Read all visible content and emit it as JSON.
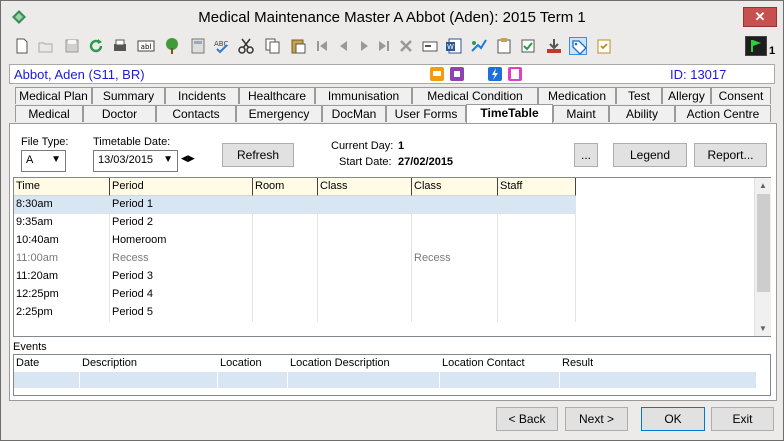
{
  "window": {
    "title": "Medical Maintenance   Master A Abbot (Aden): 2015 Term 1",
    "close_symbol": "✕"
  },
  "toolbar": {
    "icons": [
      "new-doc-icon",
      "open-icon",
      "save-icon",
      "refresh-icon",
      "print-icon",
      "abl-icon",
      "tree-icon",
      "calculator-icon",
      "spellcheck-icon",
      "cut-icon",
      "copy-icon",
      "paste-icon",
      "first-icon",
      "prev-icon",
      "next-icon",
      "last-icon",
      "delete-icon",
      "card-icon",
      "word-icon",
      "forward-icon",
      "clipboard-icon",
      "approve-icon",
      "download-icon",
      "tag-icon",
      "checklist-icon"
    ],
    "right_count": "1"
  },
  "student": {
    "name": "Abbot, Aden (S11, BR)",
    "id_text": "ID: 13017"
  },
  "tabs": {
    "row1": [
      "Medical Plan",
      "Summary",
      "Incidents",
      "Healthcare",
      "Immunisation",
      "Medical Condition",
      "Medication",
      "Test",
      "Allergy",
      "Consent"
    ],
    "row2": [
      "Medical",
      "Doctor",
      "Contacts",
      "Emergency",
      "DocMan",
      "User Forms",
      "TimeTable",
      "Maint",
      "Ability",
      "Action Centre"
    ],
    "selected": "TimeTable"
  },
  "filters": {
    "file_type_label": "File Type:",
    "file_type_value": "A",
    "timetable_date_label": "Timetable Date:",
    "timetable_date_value": "13/03/2015",
    "refresh_label": "Refresh",
    "current_day_label": "Current Day:",
    "current_day_value": "1",
    "start_date_label": "Start Date:",
    "start_date_value": "27/02/2015",
    "ellipsis_label": "...",
    "legend_label": "Legend",
    "report_label": "Report..."
  },
  "timetable": {
    "columns": [
      "Time",
      "Period",
      "Room",
      "Class",
      "Class Description",
      "Staff"
    ],
    "rows": [
      {
        "time": "8:30am",
        "period": "Period 1",
        "room": "",
        "class": "",
        "desc": "",
        "staff": ""
      },
      {
        "time": "9:35am",
        "period": "Period 2",
        "room": "",
        "class": "",
        "desc": "",
        "staff": ""
      },
      {
        "time": "10:40am",
        "period": "Homeroom",
        "room": "",
        "class": "",
        "desc": "",
        "staff": ""
      },
      {
        "time": "11:00am",
        "period": "Recess",
        "room": "",
        "class": "",
        "desc": "Recess",
        "staff": ""
      },
      {
        "time": "11:20am",
        "period": "Period 3",
        "room": "",
        "class": "",
        "desc": "",
        "staff": ""
      },
      {
        "time": "12:25pm",
        "period": "Period 4",
        "room": "",
        "class": "",
        "desc": "",
        "staff": ""
      },
      {
        "time": "2:25pm",
        "period": "Period 5",
        "room": "",
        "class": "",
        "desc": "",
        "staff": ""
      }
    ]
  },
  "events": {
    "label": "Events",
    "columns": [
      "Date",
      "Description",
      "Location",
      "Location Description",
      "Location Contact",
      "Result"
    ]
  },
  "footer": {
    "back_label": "< Back",
    "next_label": "Next >",
    "ok_label": "OK",
    "exit_label": "Exit"
  }
}
